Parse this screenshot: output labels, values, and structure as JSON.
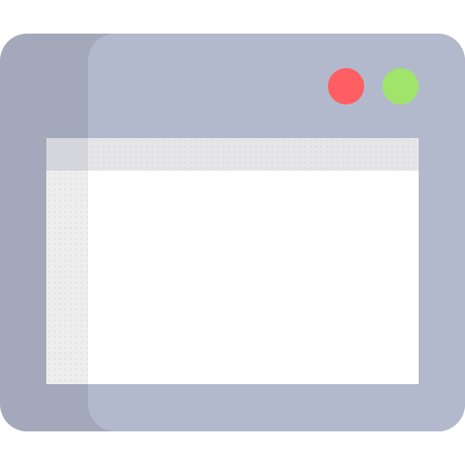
{
  "window_icon": {
    "icon_name": "browser-window-icon",
    "controls": [
      {
        "name": "close-dot",
        "color": "#ff5f63"
      },
      {
        "name": "maximize-dot",
        "color": "#a0e46b"
      }
    ],
    "colors": {
      "frame_dark": "#a3a9ba",
      "frame_light": "#b3b9cc",
      "content": "#ffffff",
      "titlebar": "#e6e6e8"
    }
  }
}
